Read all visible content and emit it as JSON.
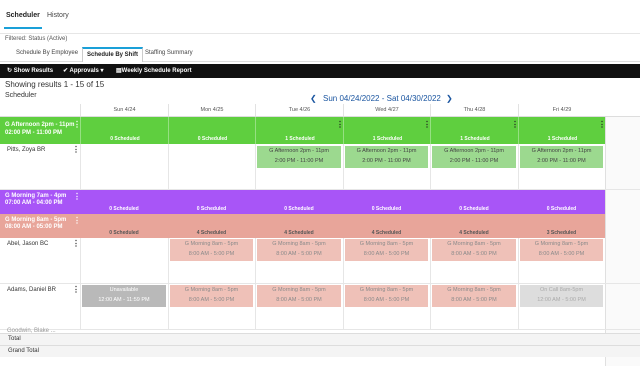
{
  "top_tabs": {
    "scheduler": "Scheduler",
    "history": "History"
  },
  "filter_text": "Filtered: Status (Active)",
  "sub_tabs": {
    "by_employee": "Schedule By Employee",
    "by_shift": "Schedule By Shift",
    "staffing": "Staffing Summary"
  },
  "toolbar": {
    "show_results": "Show Results",
    "approvals": "Approvals",
    "weekly_report": "Weekly Schedule Report"
  },
  "showing_results": "Showing results 1 - 15 of 15",
  "scheduler_label": "Scheduler",
  "date_range": "Sun 04/24/2022 - Sat 04/30/2022",
  "days": [
    "Sun 4/24",
    "Mon 4/25",
    "Tue 4/26",
    "Wed 4/27",
    "Thu 4/28",
    "Fri 4/29"
  ],
  "bands": {
    "afternoon": {
      "title": "G Afternoon 2pm - 11pm",
      "time": "02:00 PM - 11:00 PM",
      "counts": [
        "0 Scheduled",
        "0 Scheduled",
        "1 Scheduled",
        "1 Scheduled",
        "1 Scheduled",
        "1 Scheduled"
      ],
      "color": "#5fcf3f"
    },
    "morning7": {
      "title": "G Morning 7am - 4pm",
      "time": "07:00 AM - 04:00 PM",
      "counts": [
        "0 Scheduled",
        "0 Scheduled",
        "0 Scheduled",
        "0 Scheduled",
        "0 Scheduled",
        "0 Scheduled"
      ],
      "color": "#a855f7"
    },
    "morning8": {
      "title": "G Morning 8am - 5pm",
      "time": "08:00 AM - 05:00 PM",
      "counts": [
        "0 Scheduled",
        "4 Scheduled",
        "4 Scheduled",
        "4 Scheduled",
        "4 Scheduled",
        "3 Scheduled"
      ],
      "color": "#e8a59a"
    }
  },
  "employees": {
    "pitts": {
      "name": "Pitts, Zoya BR"
    },
    "abel": {
      "name": "Abel, Jason BC"
    },
    "adams": {
      "name": "Adams, Daniel BR"
    },
    "partial": {
      "name": "Goodwin, Blake ..."
    }
  },
  "cards": {
    "afternoon_title": "G Afternoon 2pm - 11pm",
    "afternoon_time": "2:00 PM - 11:00 PM",
    "morning_title": "G Morning 8am - 5pm",
    "morning_time": "8:00 AM - 5:00 PM",
    "unavailable_title": "Unavailable",
    "unavailable_time": "12:00 AM - 11:59 PM",
    "oncall_title": "On Call 8am-5pm",
    "oncall_time": "12:00 AM - 5:00 PM"
  },
  "totals": {
    "total": "Total",
    "grand_total": "Grand Total"
  }
}
